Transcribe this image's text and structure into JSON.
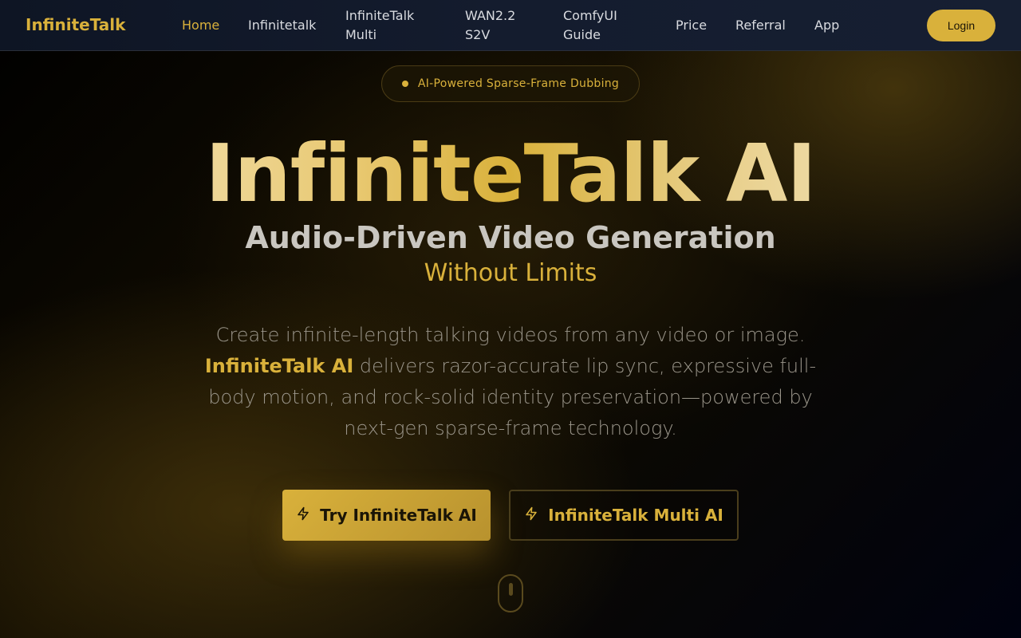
{
  "header": {
    "logo": "InfiniteTalk",
    "nav": [
      {
        "label": "Home",
        "active": true
      },
      {
        "label": "Infinitetalk"
      },
      {
        "label": "InfiniteTalk Multi"
      },
      {
        "label": "WAN2.2 S2V"
      },
      {
        "label": "ComfyUI Guide"
      },
      {
        "label": "Price"
      },
      {
        "label": "Referral"
      },
      {
        "label": "App"
      }
    ],
    "login_label": "Login"
  },
  "badge": {
    "text": "AI-Powered Sparse-Frame Dubbing"
  },
  "hero": {
    "title": "InfiniteTalk AI",
    "subtitle": "Audio-Driven Video Generation",
    "tagline": "Without Limits",
    "desc_part1": "Create infinite-length talking videos from any video or image.",
    "desc_highlight": "InfiniteTalk AI",
    "desc_part2": "delivers razor-accurate lip sync, expressive full-body motion, and rock-solid identity preservation—powered by next-gen sparse-frame technology."
  },
  "buttons": {
    "primary_label": "Try InfiniteTalk AI",
    "secondary_label": "InfiniteTalk Multi AI"
  },
  "colors": {
    "accent": "#d9b13b",
    "background": "#000000",
    "header_bg": "#141c2e"
  },
  "icons": {
    "button_icon": "lightning-bolt-icon",
    "scroll_indicator": "mouse-scroll-icon"
  }
}
